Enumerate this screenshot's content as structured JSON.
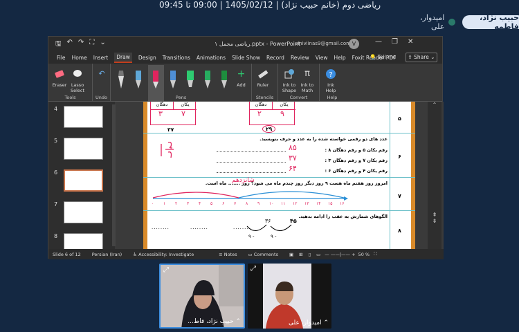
{
  "meeting": {
    "title": "ریاضی دوم (خانم حبیب نژاد) | 1405/02/12 | 09:00 تا 09:45"
  },
  "participants": {
    "active": "حبیب نژاد، فاطمه",
    "other": "امیدوار، علی"
  },
  "powerpoint": {
    "doc_title": "ریاضی مجمل ۱.pptx  -  PowerPoint",
    "account": "viniviinas9@gmail.com",
    "avatar": "V",
    "menu": [
      "File",
      "Home",
      "Insert",
      "Draw",
      "Design",
      "Transitions",
      "Animations",
      "Slide Show",
      "Record",
      "Review",
      "View",
      "Help",
      "Foxit Reader PDF"
    ],
    "tell_me": "Tell me",
    "share": "Share",
    "ribbon": {
      "tools": {
        "eraser": "Eraser",
        "lasso": "Lasso Select",
        "label": "Tools"
      },
      "undo": {
        "label": "Undo"
      },
      "pens": {
        "label": "Pens",
        "colors": [
          "#e8e8e8",
          "#5fa8d8",
          "#e0245e",
          "#4f8fd6",
          "#2ecc71",
          "#27ae60",
          "#1e8e3e"
        ]
      },
      "add": {
        "label": "Add"
      },
      "stencils": {
        "ruler": "Ruler",
        "label": "Stencils"
      },
      "convert": {
        "ink_shape": "Ink to Shape",
        "ink_math": "Ink to Math",
        "label": "Convert"
      },
      "help": {
        "ink_help": "Ink Help",
        "label": "Help"
      }
    },
    "thumbnails": [
      {
        "num": "4"
      },
      {
        "num": "5"
      },
      {
        "num": "6"
      },
      {
        "num": "7"
      },
      {
        "num": "8"
      }
    ],
    "slide": {
      "row5": {
        "num": "۵",
        "headers": [
          "دهگان",
          "یکان",
          "دهگان",
          "یکان"
        ],
        "digits": [
          "۳",
          "۷",
          "۲",
          "۹"
        ],
        "results": [
          "۳۷",
          "۲۹"
        ]
      },
      "row6": {
        "num": "۶",
        "question": "عدد های دو رقمی خواسته شده را به عدد و حرف بنویسید.",
        "items": [
          "رقم یکان ۵ و رقم دهگان ۸ :",
          "رقم یکان ۷ و رقم دهگان ۳ :",
          "رقم یکان ۴ و رقم دهگان ۶ :"
        ],
        "answers": [
          "۸۵",
          "۳۷",
          "۶۴"
        ]
      },
      "row7": {
        "num": "۷",
        "question": "امروز روز هفتم ماه هست ۹ روز دیگر روز چندم ماه می شود؟ روز ....... ماه است.",
        "answer": "شانزدهم",
        "ticks": [
          "۰",
          "۱",
          "۲",
          "۳",
          "۴",
          "۵",
          "۶",
          "۷",
          "۸",
          "۹",
          "۱۰",
          "۱۱",
          "۱۲",
          "۱۳",
          "۱۴",
          "۱۵",
          "۱۶"
        ]
      },
      "row8": {
        "num": "۸",
        "question": "الگوهای شمارش به عقب را ادامه بدهید.",
        "values": [
          "۴۵",
          "۳۶",
          "۹ -",
          "۹ -"
        ]
      }
    },
    "status": {
      "slide": "Slide 6 of 12",
      "lang": "Persian (Iran)",
      "access": "Accessibility: Investigate",
      "notes": "Notes",
      "comments": "Comments",
      "zoom": "50 %"
    }
  },
  "videos": [
    {
      "name": "حبیب نژاد، فاط..."
    },
    {
      "name": "امیدوار، علی"
    }
  ]
}
